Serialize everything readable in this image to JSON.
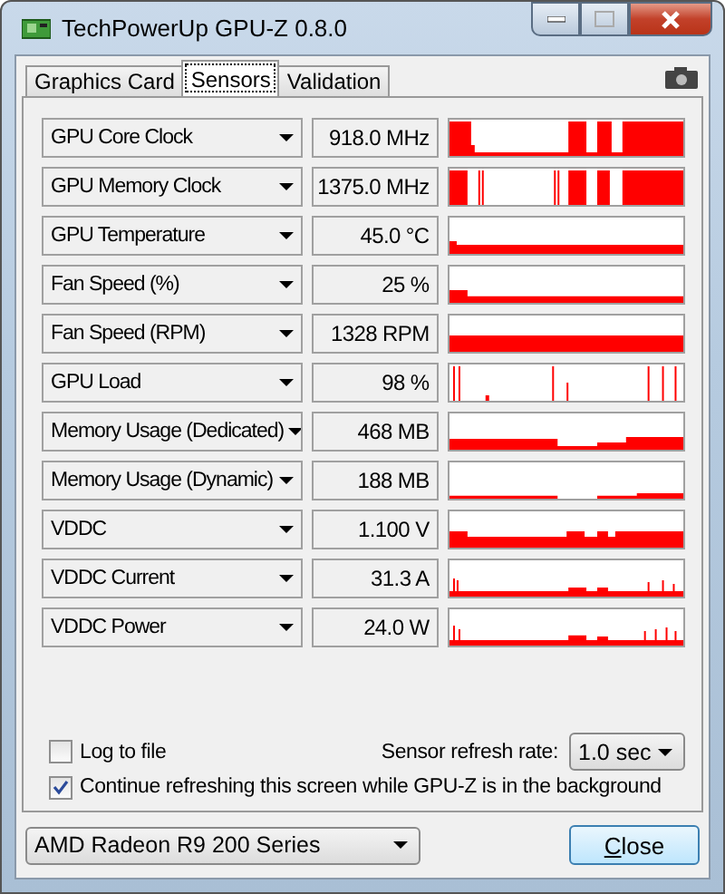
{
  "window": {
    "title": "TechPowerUp GPU-Z 0.8.0"
  },
  "tabs": [
    {
      "label": "Graphics Card",
      "selected": false
    },
    {
      "label": "Sensors",
      "selected": true
    },
    {
      "label": "Validation",
      "selected": false
    }
  ],
  "sensors": [
    {
      "name": "GPU Core Clock",
      "value": "918.0 MHz"
    },
    {
      "name": "GPU Memory Clock",
      "value": "1375.0 MHz"
    },
    {
      "name": "GPU Temperature",
      "value": "45.0 °C"
    },
    {
      "name": "Fan Speed (%)",
      "value": "25 %"
    },
    {
      "name": "Fan Speed (RPM)",
      "value": "1328 RPM"
    },
    {
      "name": "GPU Load",
      "value": "98 %"
    },
    {
      "name": "Memory Usage (Dedicated)",
      "value": "468 MB"
    },
    {
      "name": "Memory Usage (Dynamic)",
      "value": "188 MB"
    },
    {
      "name": "VDDC",
      "value": "1.100 V"
    },
    {
      "name": "VDDC Current",
      "value": "31.3 A"
    },
    {
      "name": "VDDC Power",
      "value": "24.0 W"
    }
  ],
  "log_to_file": {
    "label": "Log to file",
    "checked": false
  },
  "refresh_rate": {
    "label": "Sensor refresh rate:",
    "value": "1.0 sec"
  },
  "continue_refreshing": {
    "label": "Continue refreshing this screen while GPU-Z is in the background",
    "checked": true
  },
  "gpu_select": {
    "value": "AMD Radeon R9 200 Series"
  },
  "close_button": {
    "label": "Close"
  }
}
